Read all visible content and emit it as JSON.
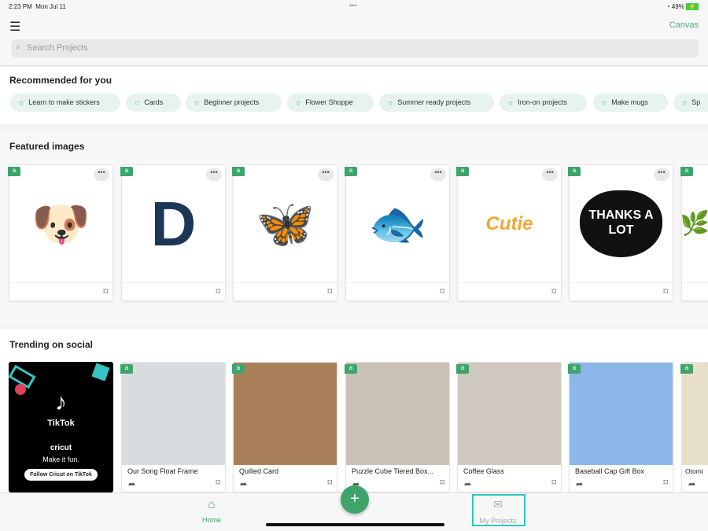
{
  "status": {
    "time": "2:23 PM",
    "date": "Mon Jul 11",
    "battery": "49%"
  },
  "header": {
    "menu_icon": "hamburger-icon",
    "canvas_label": "Canvas",
    "search_placeholder": "Search Projects"
  },
  "recommended": {
    "title": "Recommended for you",
    "chips": [
      "Learn to make stickers",
      "Cards",
      "Beginner projects",
      "Flower Shoppe",
      "Summer ready projects",
      "Iron-on projects",
      "Make mugs",
      "Sp"
    ]
  },
  "featured": {
    "title": "Featured images",
    "items": [
      "party dog",
      "D forest",
      "butterfly",
      "fish",
      "Cutie strawberries",
      "THANKS A LOT heart",
      "branch"
    ],
    "heart_text": "THANKS A LOT",
    "cutie_text": "Cutie"
  },
  "trending": {
    "title": "Trending on social",
    "tiktok": {
      "brand": "TikTok",
      "cricut": "cricut",
      "tagline": "Make it fun.",
      "button": "Follow Cricut on TikTok"
    },
    "items": [
      "Our Song Float Frame",
      "Quilled Card",
      "Puzzle Cube Tiered Box...",
      "Coffee Glass",
      "Baseball Cap Gift Box",
      "Otomi"
    ]
  },
  "tabbar": {
    "home": "Home",
    "projects": "My Projects"
  },
  "colors": {
    "accent": "#3fa46b",
    "highlight": "#2cc7c0"
  }
}
